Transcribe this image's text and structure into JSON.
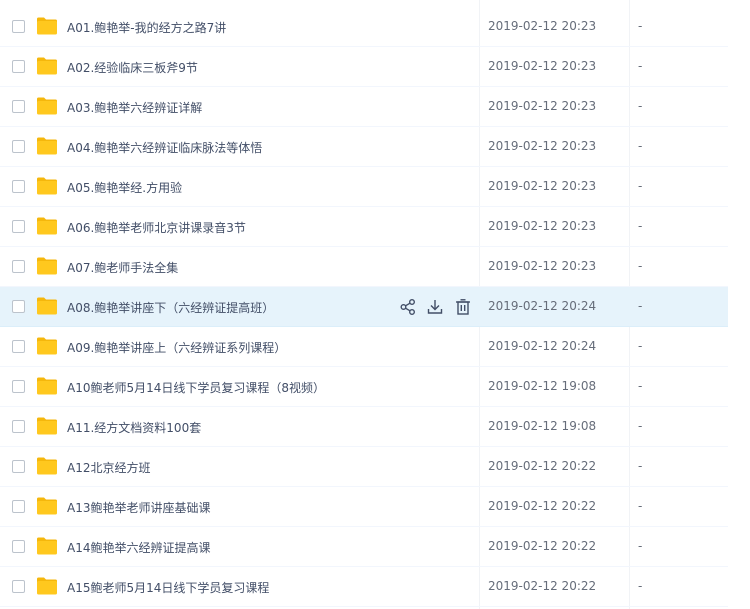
{
  "files": [
    {
      "name": "A01.鲍艳举-我的经方之路7讲",
      "modified": "2019-02-12 20:23",
      "size": "-"
    },
    {
      "name": "A02.经验临床三板斧9节",
      "modified": "2019-02-12 20:23",
      "size": "-"
    },
    {
      "name": "A03.鲍艳举六经辨证详解",
      "modified": "2019-02-12 20:23",
      "size": "-"
    },
    {
      "name": "A04.鲍艳举六经辨证临床脉法等体悟",
      "modified": "2019-02-12 20:23",
      "size": "-"
    },
    {
      "name": "A05.鲍艳举经.方用验",
      "modified": "2019-02-12 20:23",
      "size": "-"
    },
    {
      "name": "A06.鲍艳举老师北京讲课录音3节",
      "modified": "2019-02-12 20:23",
      "size": "-"
    },
    {
      "name": "A07.鲍老师手法全集",
      "modified": "2019-02-12 20:23",
      "size": "-"
    },
    {
      "name": "A08.鲍艳举讲座下（六经辨证提高班）",
      "modified": "2019-02-12 20:24",
      "size": "-"
    },
    {
      "name": "A09.鲍艳举讲座上（六经辨证系列课程）",
      "modified": "2019-02-12 20:24",
      "size": "-"
    },
    {
      "name": "A10鲍老师5月14日线下学员复习课程（8视频）",
      "modified": "2019-02-12 19:08",
      "size": "-"
    },
    {
      "name": "A11.经方文档资料100套",
      "modified": "2019-02-12 19:08",
      "size": "-"
    },
    {
      "name": "A12北京经方班",
      "modified": "2019-02-12 20:22",
      "size": "-"
    },
    {
      "name": "A13鲍艳举老师讲座基础课",
      "modified": "2019-02-12 20:22",
      "size": "-"
    },
    {
      "name": "A14鲍艳举六经辨证提高课",
      "modified": "2019-02-12 20:22",
      "size": "-"
    },
    {
      "name": "A15鲍老师5月14日线下学员复习课程",
      "modified": "2019-02-12 20:22",
      "size": "-"
    }
  ],
  "hover_row_index": 7,
  "row_actions": [
    {
      "icon": "share-icon"
    },
    {
      "icon": "download-icon"
    },
    {
      "icon": "delete-icon"
    }
  ],
  "colors": {
    "folder": "#ffc81e",
    "folder_tab": "#f5b70c",
    "hover_background": "#e6f3fb",
    "action_icon": "#424e67"
  }
}
